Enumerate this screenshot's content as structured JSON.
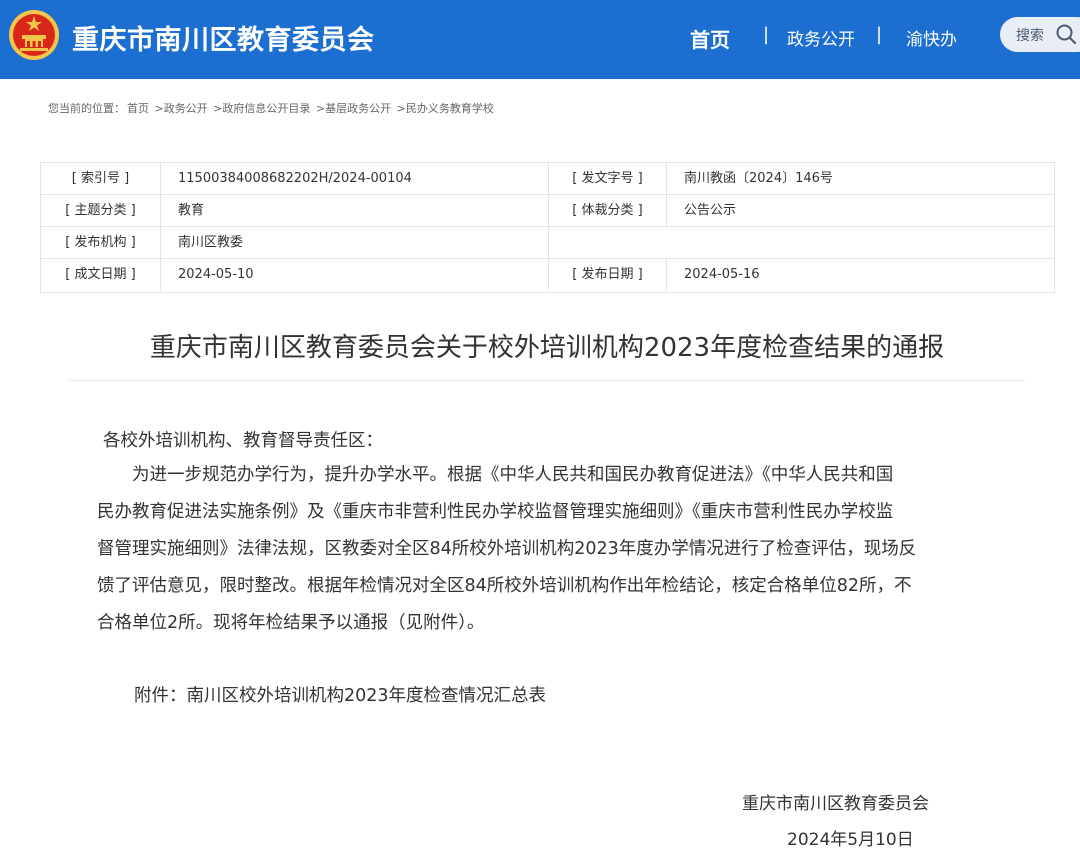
{
  "header": {
    "site_title": "重庆市南川区教育委员会",
    "nav": {
      "home": "首页",
      "separator": "|",
      "gov_affairs": "政务公开",
      "yukuaiban": "渝快办"
    },
    "search_label": "搜索",
    "icons": {
      "emblem": "national-emblem-icon",
      "search": "search-icon"
    },
    "colors": {
      "header_bg": "#1c6fd1",
      "emblem_red": "#d8261b",
      "emblem_gold": "#f3c64a"
    }
  },
  "breadcrumb": {
    "prefix": "您当前的位置：",
    "items": [
      "首页",
      ">政务公开",
      ">政府信息公开目录",
      ">基层政务公开",
      ">民办义务教育学校"
    ]
  },
  "meta": {
    "rows": [
      {
        "label1": "[ 索引号 ]",
        "value1": "11500384008682202H/2024-00104",
        "label2": "[ 发文字号 ]",
        "value2": "南川教函〔2024〕146号"
      },
      {
        "label1": "[ 主题分类 ]",
        "value1": "教育",
        "label2": "[ 体裁分类 ]",
        "value2": "公告公示"
      },
      {
        "label1": "[ 发布机构 ]",
        "value1": "南川区教委",
        "label2": "",
        "value2": ""
      },
      {
        "label1": "[ 成文日期 ]",
        "value1": "2024-05-10",
        "label2": "[ 发布日期 ]",
        "value2": "2024-05-16"
      }
    ]
  },
  "article": {
    "title": "重庆市南川区教育委员会关于校外培训机构2023年度检查结果的通报",
    "salutation": "各校外培训机构、教育督导责任区：",
    "paragraph_lines": [
      "　　为进一步规范办学行为，提升办学水平。根据《中华人民共和国民办教育促进法》《中华人民共和国",
      "民办教育促进法实施条例》及《重庆市非营利性民办学校监督管理实施细则》《重庆市营利性民办学校监",
      "督管理实施细则》法律法规，区教委对全区84所校外培训机构2023年度办学情况进行了检查评估，现场反",
      "馈了评估意见，限时整改。根据年检情况对全区84所校外培训机构作出年检结论，核定合格单位82所，不",
      "合格单位2所。现将年检结果予以通报（见附件）。"
    ],
    "attachment": "附件：南川区校外培训机构2023年度检查情况汇总表",
    "sign_org": "重庆市南川区教育委员会",
    "sign_date": "2024年5月10日"
  }
}
